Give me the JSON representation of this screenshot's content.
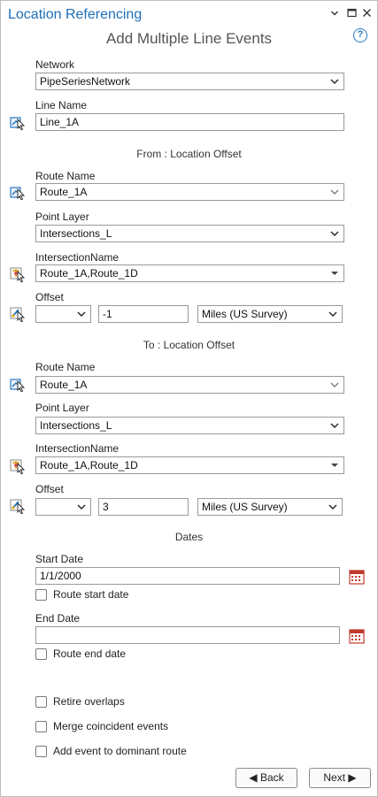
{
  "window": {
    "title": "Location Referencing"
  },
  "header": {
    "subtitle": "Add Multiple Line Events",
    "help": "?"
  },
  "network": {
    "label": "Network",
    "value": "PipeSeriesNetwork"
  },
  "line_name": {
    "label": "Line Name",
    "value": "Line_1A"
  },
  "from": {
    "section": "From : Location Offset",
    "route_name_label": "Route Name",
    "route_name": "Route_1A",
    "point_layer_label": "Point Layer",
    "point_layer": "Intersections_L",
    "intersection_label": "IntersectionName",
    "intersection": "Route_1A,Route_1D",
    "offset_label": "Offset",
    "offset_direction": "",
    "offset_value": "-1",
    "offset_units": "Miles (US Survey)"
  },
  "to": {
    "section": "To : Location Offset",
    "route_name_label": "Route Name",
    "route_name": "Route_1A",
    "point_layer_label": "Point Layer",
    "point_layer": "Intersections_L",
    "intersection_label": "IntersectionName",
    "intersection": "Route_1A,Route_1D",
    "offset_label": "Offset",
    "offset_direction": "",
    "offset_value": "3",
    "offset_units": "Miles (US Survey)"
  },
  "dates": {
    "section": "Dates",
    "start_label": "Start Date",
    "start_value": "1/1/2000",
    "route_start_label": "Route start date",
    "end_label": "End Date",
    "end_value": "",
    "route_end_label": "Route end date"
  },
  "options": {
    "retire_overlaps": "Retire overlaps",
    "merge_coincident": "Merge coincident events",
    "add_to_dominant": "Add event to dominant route"
  },
  "buttons": {
    "back": "◀ Back",
    "next": "Next ▶"
  },
  "colors": {
    "title": "#1d6fb8",
    "help": "#2b79c2",
    "calendar": "#c0392b"
  }
}
